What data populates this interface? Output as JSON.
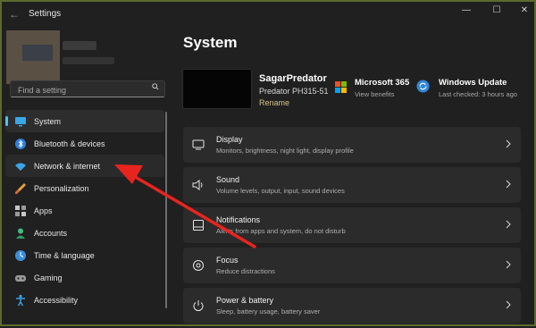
{
  "window": {
    "title": "Settings",
    "back_glyph": "←",
    "minimize_glyph": "—",
    "maximize_glyph": "☐",
    "close_glyph": "✕"
  },
  "search": {
    "placeholder": "Find a setting"
  },
  "sidebar": {
    "items": [
      {
        "label": "System",
        "icon": "monitor-icon",
        "active": true
      },
      {
        "label": "Bluetooth & devices",
        "icon": "bluetooth-icon"
      },
      {
        "label": "Network & internet",
        "icon": "wifi-icon",
        "hover": true
      },
      {
        "label": "Personalization",
        "icon": "brush-icon"
      },
      {
        "label": "Apps",
        "icon": "apps-icon"
      },
      {
        "label": "Accounts",
        "icon": "person-icon"
      },
      {
        "label": "Time & language",
        "icon": "globe-clock-icon"
      },
      {
        "label": "Gaming",
        "icon": "gamepad-icon"
      },
      {
        "label": "Accessibility",
        "icon": "accessibility-icon"
      }
    ]
  },
  "main": {
    "title": "System",
    "device": {
      "name": "SagarPredator",
      "model": "Predator PH315-51",
      "rename": "Rename"
    },
    "ms365": {
      "title": "Microsoft 365",
      "subtitle": "View benefits"
    },
    "windows_update": {
      "title": "Windows Update",
      "subtitle": "Last checked: 3 hours ago"
    },
    "cards": [
      {
        "title": "Display",
        "subtitle": "Monitors, brightness, night light, display profile",
        "icon": "display-icon"
      },
      {
        "title": "Sound",
        "subtitle": "Volume levels, output, input, sound devices",
        "icon": "speaker-icon"
      },
      {
        "title": "Notifications",
        "subtitle": "Alerts from apps and system, do not disturb",
        "icon": "bell-icon"
      },
      {
        "title": "Focus",
        "subtitle": "Reduce distractions",
        "icon": "focus-icon"
      },
      {
        "title": "Power & battery",
        "subtitle": "Sleep, battery usage, battery saver",
        "icon": "power-icon"
      }
    ]
  },
  "colors": {
    "accent": "#4cc2ff",
    "annotation_arrow": "#e8241e",
    "background": "#202020",
    "card": "#2b2b2b"
  }
}
